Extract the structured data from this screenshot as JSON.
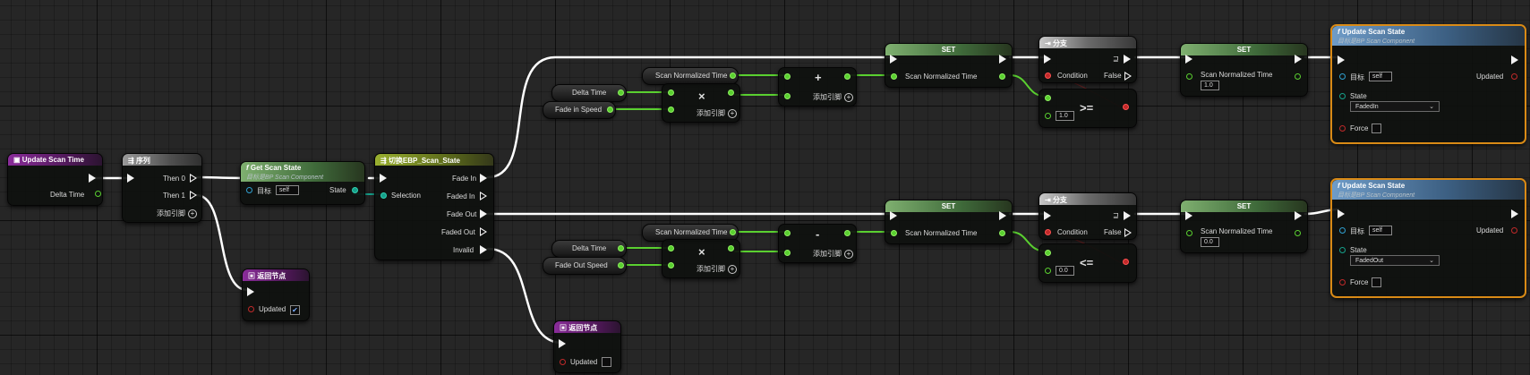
{
  "nodes": {
    "event": {
      "title": "Update Scan Time",
      "delta_time": "Delta Time"
    },
    "sequence": {
      "title": "序列",
      "then0": "Then 0",
      "then1": "Then 1",
      "add_pin": "添加引脚"
    },
    "return_top": {
      "title": "返回节点",
      "updated": "Updated"
    },
    "get_scan_state": {
      "title": "Get Scan State",
      "subtitle": "目标是BP Scan Component",
      "target_label": "目标",
      "target_value": "self",
      "state_label": "State"
    },
    "switch": {
      "title": "切换EBP_Scan_State",
      "selection": "Selection",
      "fade_in": "Fade In",
      "faded_in": "Faded In",
      "fade_out": "Fade Out",
      "faded_out": "Faded Out",
      "invalid": "Invalid"
    },
    "return_bottom": {
      "title": "返回节点",
      "updated": "Updated"
    },
    "top_row": {
      "delta_time": "Delta Time",
      "fade_speed": "Fade in Speed",
      "scan_time_get": "Scan Normalized Time",
      "mult_add_pin": "添加引脚",
      "add_add_pin": "添加引脚",
      "mult_op": "×",
      "add_op": "+",
      "set_title": "SET",
      "set_var": "Scan Normalized Time",
      "branch_title": "分支",
      "condition": "Condition",
      "false_label": "False",
      "compare_op": ">=",
      "compare_value": "1.0",
      "set2_title": "SET",
      "set2_var": "Scan Normalized Time",
      "set2_value": "1.0",
      "update_title": "Update Scan State",
      "update_subtitle": "目标是BP Scan Component",
      "update_target_label": "目标",
      "update_target_value": "self",
      "update_state_label": "State",
      "update_state_value": "FadedIn",
      "update_force": "Force",
      "update_updated": "Updated"
    },
    "bottom_row": {
      "delta_time": "Delta Time",
      "fade_speed": "Fade Out Speed",
      "scan_time_get": "Scan Normalized Time",
      "mult_add_pin": "添加引脚",
      "add_add_pin": "添加引脚",
      "mult_op": "×",
      "add_op": "-",
      "set_title": "SET",
      "set_var": "Scan Normalized Time",
      "branch_title": "分支",
      "condition": "Condition",
      "false_label": "False",
      "compare_op": "<=",
      "compare_value": "0.0",
      "set2_title": "SET",
      "set2_var": "Scan Normalized Time",
      "set2_value": "0.0",
      "update_title": "Update Scan State",
      "update_subtitle": "目标是BP Scan Component",
      "update_target_label": "目标",
      "update_target_value": "self",
      "update_state_label": "State",
      "update_state_value": "FadedOut",
      "update_force": "Force",
      "update_updated": "Updated"
    }
  },
  "colors": {
    "exec_wire": "#ffffff",
    "float_wire": "#5ad030",
    "enum_wire": "#16a08a",
    "selection_outline": "#d98a16"
  }
}
